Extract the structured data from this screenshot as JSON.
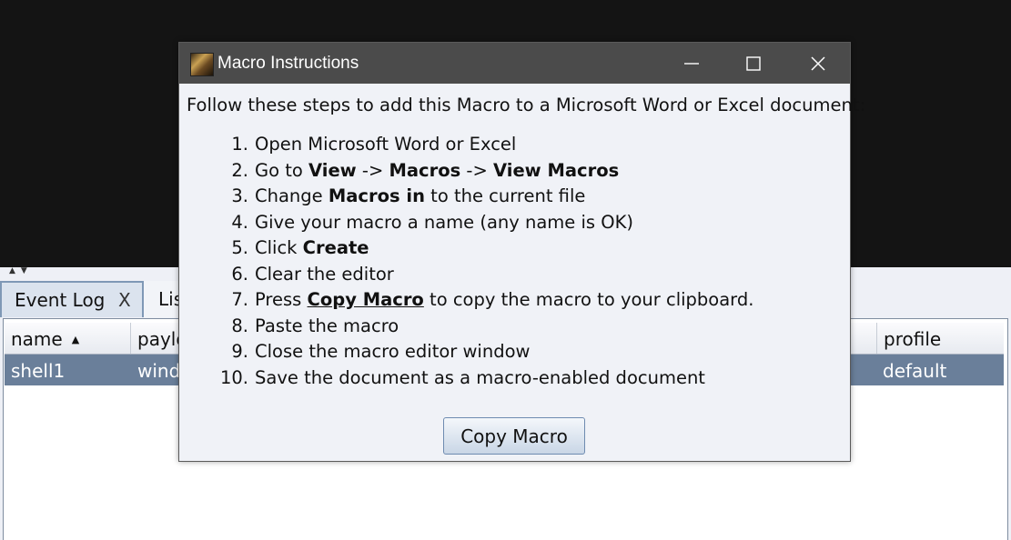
{
  "background": {
    "tabs": [
      {
        "label": "Event Log",
        "close": "X"
      },
      {
        "label": "Lis"
      }
    ],
    "table": {
      "columns": {
        "name": "name",
        "payload": "paylo",
        "profile": "profile"
      },
      "rows": [
        {
          "name": "shell1",
          "payload": "windo",
          "profile": "default"
        }
      ]
    }
  },
  "dialog": {
    "title": "Macro Instructions",
    "intro": "Follow these steps to add this Macro to a Microsoft Word or Excel document:",
    "steps": [
      {
        "num": "1.",
        "parts": [
          "Open Microsoft Word or Excel"
        ]
      },
      {
        "num": "2.",
        "parts": [
          "Go to ",
          "View",
          " -> ",
          "Macros",
          " -> ",
          "View Macros"
        ]
      },
      {
        "num": "3.",
        "parts": [
          "Change ",
          "Macros in",
          " to the current file"
        ]
      },
      {
        "num": "4.",
        "parts": [
          "Give your macro a name (any name is OK)"
        ]
      },
      {
        "num": "5.",
        "parts": [
          "Click ",
          "Create"
        ]
      },
      {
        "num": "6.",
        "parts": [
          "Clear the editor"
        ]
      },
      {
        "num": "7.",
        "parts": [
          "Press ",
          "Copy Macro",
          " to copy the macro to your clipboard."
        ]
      },
      {
        "num": "8.",
        "parts": [
          "Paste the macro"
        ]
      },
      {
        "num": "9.",
        "parts": [
          "Close the macro editor window"
        ]
      },
      {
        "num": "10.",
        "parts": [
          "Save the document as a macro-enabled document"
        ]
      }
    ],
    "button_label": "Copy Macro"
  },
  "icons": [
    "app-icon",
    "minimize-icon",
    "maximize-icon",
    "close-icon",
    "sort-ascending-icon",
    "split-arrows-icon"
  ]
}
